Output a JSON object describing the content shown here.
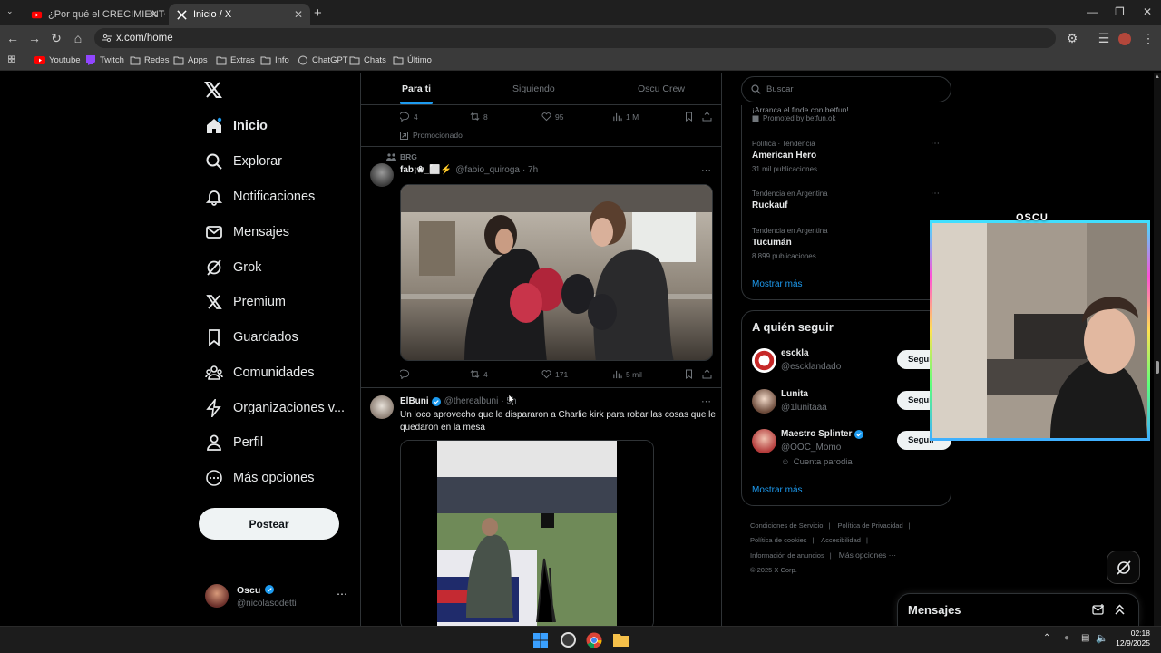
{
  "browser": {
    "tabs": [
      {
        "title": "¿Por qué el CRECIMIENTO no E",
        "active": false
      },
      {
        "title": "Inicio / X",
        "active": true
      }
    ],
    "url": "x.com/home",
    "bookmarks": [
      "Youtube",
      "Twitch",
      "Redes",
      "Apps",
      "Extras",
      "Info",
      "ChatGPT",
      "Chats",
      "Último"
    ]
  },
  "sidebar": {
    "items": [
      {
        "label": "Inicio",
        "icon": "home-icon"
      },
      {
        "label": "Explorar",
        "icon": "search-icon"
      },
      {
        "label": "Notificaciones",
        "icon": "bell-icon"
      },
      {
        "label": "Mensajes",
        "icon": "envelope-icon"
      },
      {
        "label": "Grok",
        "icon": "grok-icon"
      },
      {
        "label": "Premium",
        "icon": "x-icon"
      },
      {
        "label": "Guardados",
        "icon": "bookmark-icon"
      },
      {
        "label": "Comunidades",
        "icon": "communities-icon"
      },
      {
        "label": "Organizaciones v...",
        "icon": "lightning-icon"
      },
      {
        "label": "Perfil",
        "icon": "person-icon"
      },
      {
        "label": "Más opciones",
        "icon": "more-circle-icon"
      }
    ],
    "post_button": "Postear",
    "profile": {
      "name": "Oscu",
      "handle": "@nicolasodetti"
    }
  },
  "feed": {
    "tabs": [
      "Para ti",
      "Siguiendo",
      "Oscu Crew"
    ],
    "promo_actions": {
      "replies": "4",
      "reposts": "8",
      "likes": "95",
      "views": "1 M"
    },
    "promoted_label": "Promocionado",
    "post1": {
      "community": "BRG",
      "name": "fab¡❀_⬜⚡",
      "handle": "@fabio_quiroga",
      "time": "· 7h",
      "actions": {
        "replies": "",
        "reposts": "4",
        "likes": "171",
        "views": "5 mil"
      }
    },
    "post2": {
      "name": "ElBuni",
      "handle": "@therealbuni",
      "time": "· 5h",
      "text": "Un loco aprovecho que le dispararon a Charlie kirk para robar las cosas que le quedaron en la mesa"
    }
  },
  "right": {
    "search_placeholder": "Buscar",
    "ad_text": "¡Arranca el finde con betfun!",
    "promoted_by": "Promoted by betfun.ok",
    "trends": [
      {
        "meta": "Política · Tendencia",
        "name": "American Hero",
        "count": "31 mil publicaciones"
      },
      {
        "meta": "Tendencia en Argentina",
        "name": "Ruckauf",
        "count": ""
      },
      {
        "meta": "Tendencia en Argentina",
        "name": "Tucumán",
        "count": "8.899 publicaciones"
      }
    ],
    "show_more": "Mostrar más",
    "who_to_follow_title": "A quién seguir",
    "follow": [
      {
        "name": "esckla",
        "handle": "@escklandado",
        "extra": "",
        "button": "Seguir"
      },
      {
        "name": "Lunita",
        "handle": "@1lunitaaa",
        "extra": "",
        "button": "Seguir"
      },
      {
        "name": "Maestro Splinter",
        "handle": "@OOC_Momo",
        "extra": "Cuenta parodia",
        "button": "Seguir"
      }
    ],
    "show_more_2": "Mostrar más",
    "footer": [
      "Condiciones de Servicio",
      "Política de Privacidad",
      "Política de cookies",
      "Accesibilidad",
      "Información de anuncios",
      "Más opciones ···",
      "© 2025 X Corp."
    ],
    "messages_title": "Mensajes"
  },
  "webcam_label": "OSCU",
  "clock": {
    "time": "02:18",
    "date": "12/9/2025"
  },
  "colors": {
    "accent": "#1d9bf0",
    "background": "#000000",
    "border": "#2f3336",
    "muted": "#71767b"
  }
}
